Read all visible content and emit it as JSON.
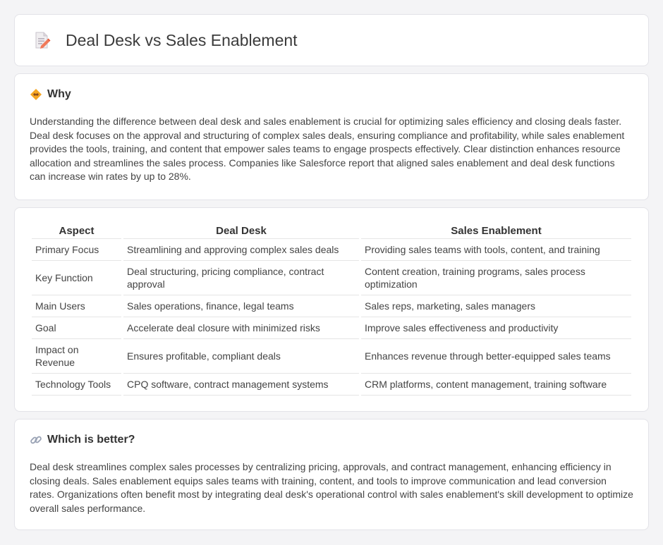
{
  "header": {
    "title": "Deal Desk vs Sales Enablement",
    "icon": "document-edit-icon"
  },
  "why": {
    "heading": "Why",
    "icon": "handshake-icon",
    "text": "Understanding the difference between deal desk and sales enablement is crucial for optimizing sales efficiency and closing deals faster. Deal desk focuses on the approval and structuring of complex sales deals, ensuring compliance and profitability, while sales enablement provides the tools, training, and content that empower sales teams to engage prospects effectively. Clear distinction enhances resource allocation and streamlines the sales process. Companies like Salesforce report that aligned sales enablement and deal desk functions can increase win rates by up to 28%."
  },
  "table": {
    "headers": [
      "Aspect",
      "Deal Desk",
      "Sales Enablement"
    ],
    "rows": [
      [
        "Primary Focus",
        "Streamlining and approving complex sales deals",
        "Providing sales teams with tools, content, and training"
      ],
      [
        "Key Function",
        "Deal structuring, pricing compliance, contract approval",
        "Content creation, training programs, sales process optimization"
      ],
      [
        "Main Users",
        "Sales operations, finance, legal teams",
        "Sales reps, marketing, sales managers"
      ],
      [
        "Goal",
        "Accelerate deal closure with minimized risks",
        "Improve sales effectiveness and productivity"
      ],
      [
        "Impact on Revenue",
        "Ensures profitable, compliant deals",
        "Enhances revenue through better-equipped sales teams"
      ],
      [
        "Technology Tools",
        "CPQ software, contract management systems",
        "CRM platforms, content management, training software"
      ]
    ]
  },
  "better": {
    "heading": "Which is better?",
    "icon": "link-icon",
    "text": "Deal desk streamlines complex sales processes by centralizing pricing, approvals, and contract management, enhancing efficiency in closing deals. Sales enablement equips sales teams with training, content, and tools to improve communication and lead conversion rates. Organizations often benefit most by integrating deal desk's operational control with sales enablement's skill development to optimize overall sales performance."
  }
}
